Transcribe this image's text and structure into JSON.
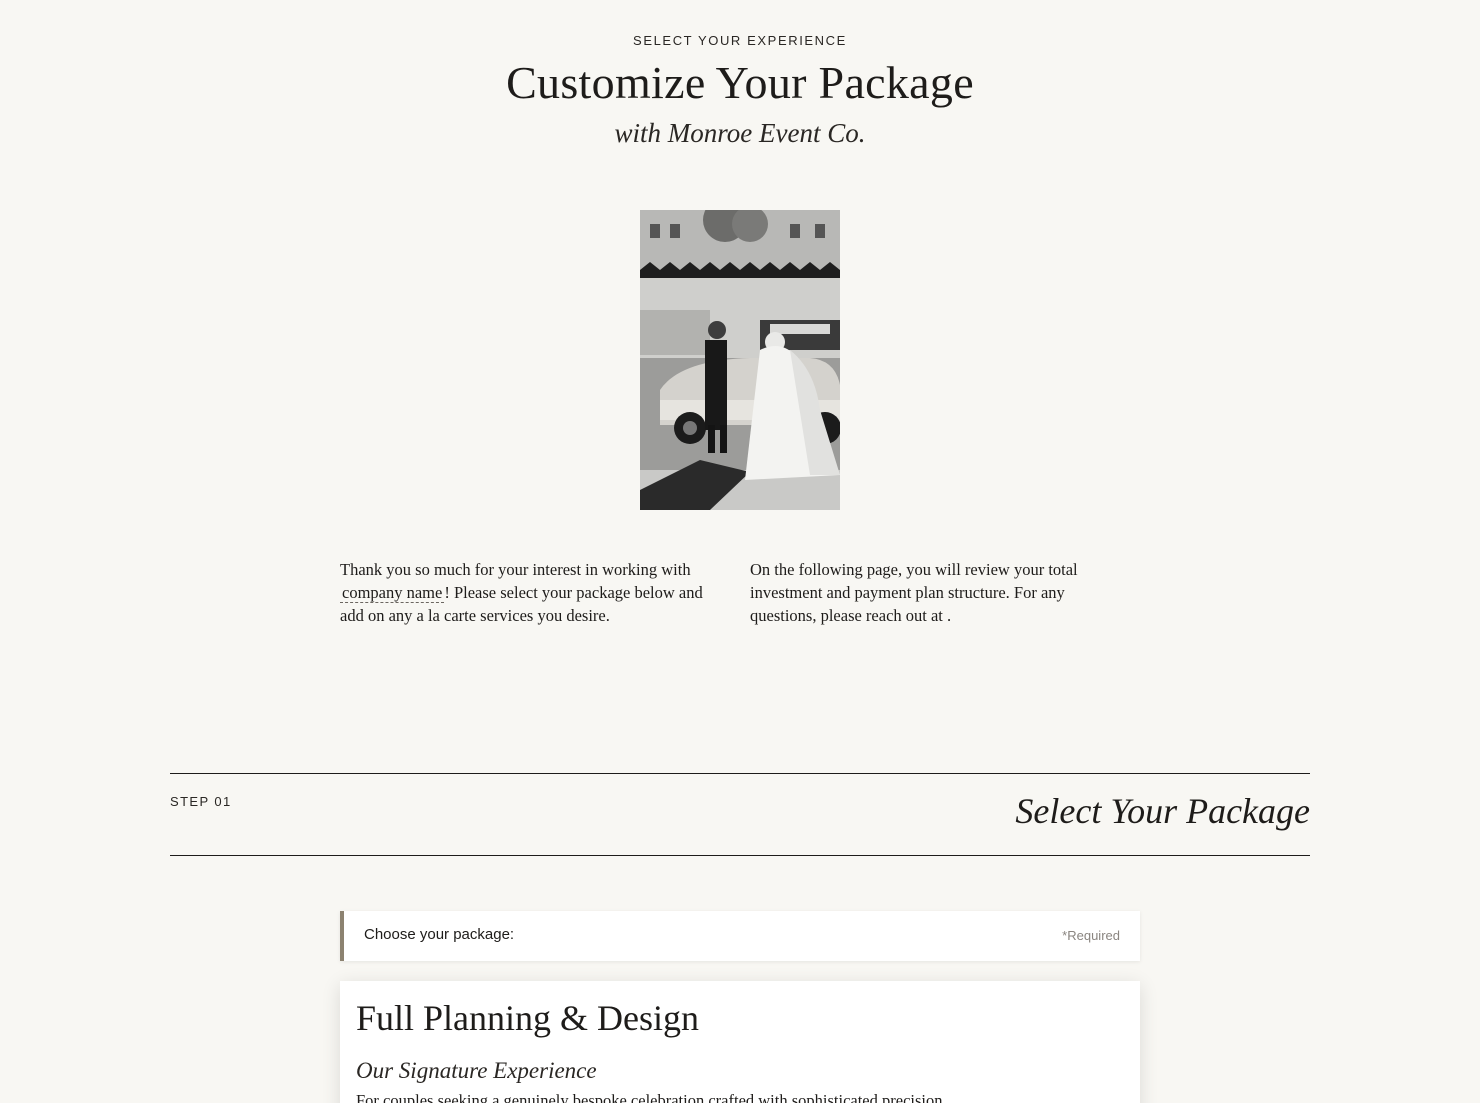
{
  "header": {
    "eyebrow": "SELECT YOUR EXPERIENCE",
    "title": "Customize Your Package",
    "subtitle": "with Monroe Event Co."
  },
  "hero_image": {
    "description": "black and white wedding couple beside vintage car"
  },
  "intro": {
    "left_before": "Thank you so much for your interest in working with ",
    "company_link": "company name",
    "left_after": "! Please select your package below and add on any a la carte services you desire.",
    "right": "On the following page, you will review your total investment and payment plan structure. For any questions, please reach out at ."
  },
  "step": {
    "number": "STEP 01",
    "title": "Select Your Package"
  },
  "package_select": {
    "label": "Choose your package:",
    "required": "*Required"
  },
  "package": {
    "name": "Full Planning & Design",
    "tagline": "Our Signature Experience",
    "description": "For couples seeking a genuinely bespoke celebration crafted with sophisticated precision."
  },
  "colors": {
    "background": "#f8f7f3",
    "accent": "#8c8270",
    "text": "#1e1c1a"
  }
}
